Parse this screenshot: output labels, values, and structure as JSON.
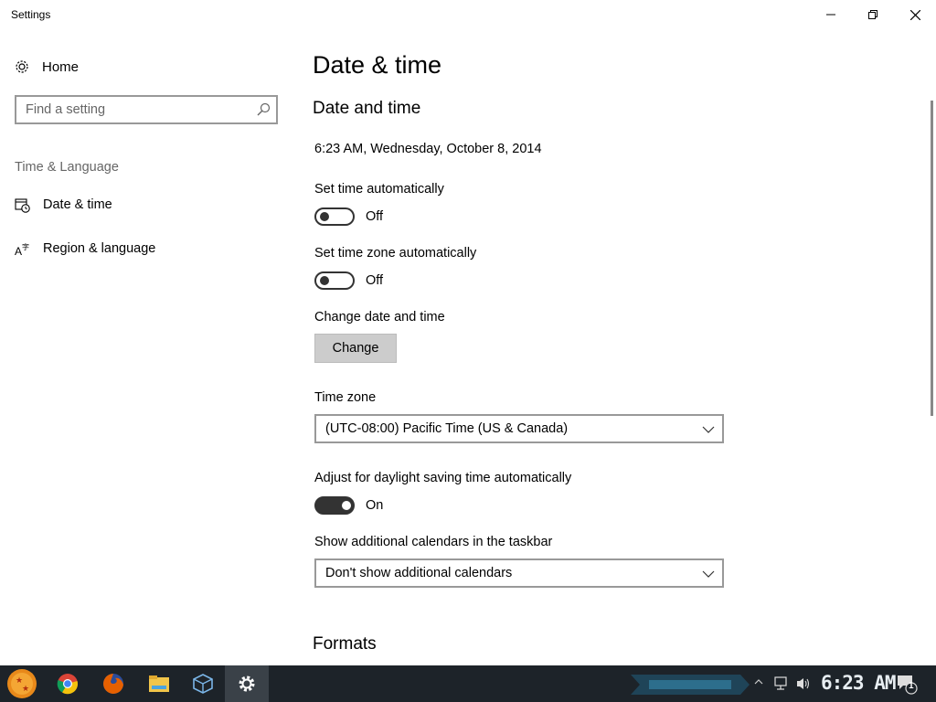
{
  "window": {
    "title": "Settings"
  },
  "sidebar": {
    "home_label": "Home",
    "search_placeholder": "Find a setting",
    "section_label": "Time & Language",
    "items": [
      {
        "label": "Date & time",
        "icon": "calendar-clock-icon",
        "active": true
      },
      {
        "label": "Region & language",
        "icon": "language-icon",
        "active": false
      }
    ]
  },
  "main": {
    "page_title": "Date & time",
    "section_title": "Date and time",
    "current_datetime": "6:23 AM, Wednesday, October 8, 2014",
    "set_time_auto": {
      "label": "Set time automatically",
      "state": "Off"
    },
    "set_timezone_auto": {
      "label": "Set time zone automatically",
      "state": "Off"
    },
    "change_datetime": {
      "label": "Change date and time",
      "button": "Change"
    },
    "time_zone": {
      "label": "Time zone",
      "value": "(UTC-08:00) Pacific Time (US & Canada)"
    },
    "daylight_saving": {
      "label": "Adjust for daylight saving time automatically",
      "state": "On"
    },
    "additional_calendars": {
      "label": "Show additional calendars in the taskbar",
      "value": "Don't show additional calendars"
    },
    "formats_title": "Formats"
  },
  "taskbar": {
    "apps": [
      "start-orb-icon",
      "chrome-icon",
      "firefox-icon",
      "file-explorer-icon",
      "virtualbox-icon",
      "settings-gear-icon"
    ],
    "clock": "6:23 AM",
    "notification_count": "1"
  },
  "colors": {
    "accent": "#0078d7",
    "toggle_dark": "#333333",
    "taskbar_bg": "#1d2329"
  }
}
